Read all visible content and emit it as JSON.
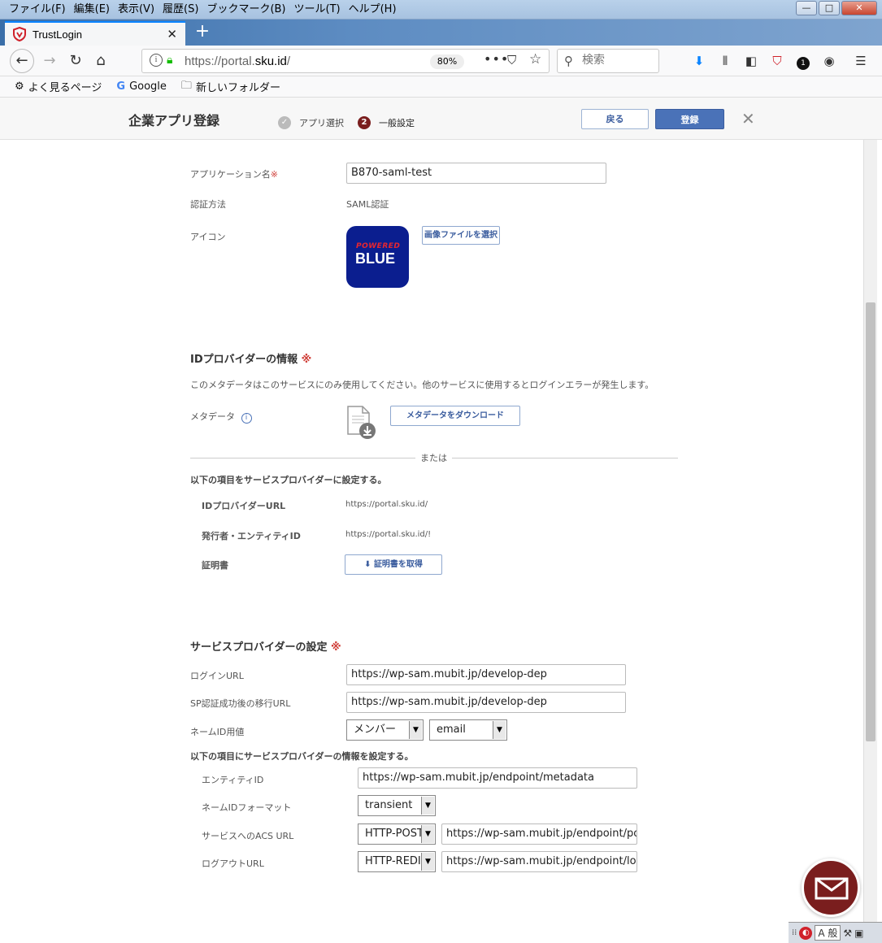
{
  "menu": [
    "ファイル(F)",
    "編集(E)",
    "表示(V)",
    "履歴(S)",
    "ブックマーク(B)",
    "ツール(T)",
    "ヘルプ(H)"
  ],
  "tab": {
    "title": "TrustLogin"
  },
  "urlbar": {
    "prefix": "https://portal.",
    "domain": "sku.id",
    "suffix": "/",
    "zoom": "80%"
  },
  "search": {
    "placeholder": "検索"
  },
  "bookmarks": [
    "よく見るページ",
    "Google",
    "新しいフォルダー"
  ],
  "header": {
    "title": "企業アプリ登録",
    "step1": "アプリ選択",
    "step2_num": "2",
    "step2": "一般設定",
    "back": "戻る",
    "register": "登録"
  },
  "form": {
    "app_name_label": "アプリケーション名",
    "app_name_value": "B870-saml-test",
    "auth_method_label": "認証方法",
    "auth_method_value": "SAML認証",
    "icon_label": "アイコン",
    "icon_powered": "POWERED",
    "icon_blue": "BLUE",
    "select_image": "画像ファイルを選択",
    "req_mark": "※"
  },
  "idp": {
    "title": "IDプロバイダーの情報",
    "note": "このメタデータはこのサービスにのみ使用してください。他のサービスに使用するとログインエラーが発生します。",
    "metadata_label": "メタデータ",
    "download_btn": "メタデータをダウンロード",
    "or": "または",
    "set_items": "以下の項目をサービスプロバイダーに設定する。",
    "idp_url_label": "IDプロバイダーURL",
    "idp_url_value": "https://portal.sku.id/",
    "issuer_label": "発行者・エンティティID",
    "issuer_value": "https://portal.sku.id/!",
    "cert_label": "証明書",
    "cert_btn": "証明書を取得"
  },
  "sp": {
    "title": "サービスプロバイダーの設定",
    "login_url_label": "ログインURL",
    "login_url_value": "https://wp-sam.mubit.jp/develop-dep",
    "redirect_label": "SP認証成功後の移行URL",
    "redirect_value": "https://wp-sam.mubit.jp/develop-dep",
    "nameid_label": "ネームID用値",
    "nameid_sel1": "メンバー",
    "nameid_sel2": "email",
    "set_items": "以下の項目にサービスプロバイダーの情報を設定する。",
    "entity_label": "エンティティID",
    "entity_value": "https://wp-sam.mubit.jp/endpoint/metadata",
    "nameid_format_label": "ネームIDフォーマット",
    "nameid_format_value": "transient",
    "acs_label": "サービスへのACS URL",
    "acs_binding": "HTTP-POST",
    "acs_value": "https://wp-sam.mubit.jp/endpoint/postR",
    "logout_label": "ログアウトURL",
    "logout_binding": "HTTP-REDIR",
    "logout_value": "https://wp-sam.mubit.jp/endpoint/logou"
  },
  "taskbar": {
    "ime": "A 般"
  }
}
